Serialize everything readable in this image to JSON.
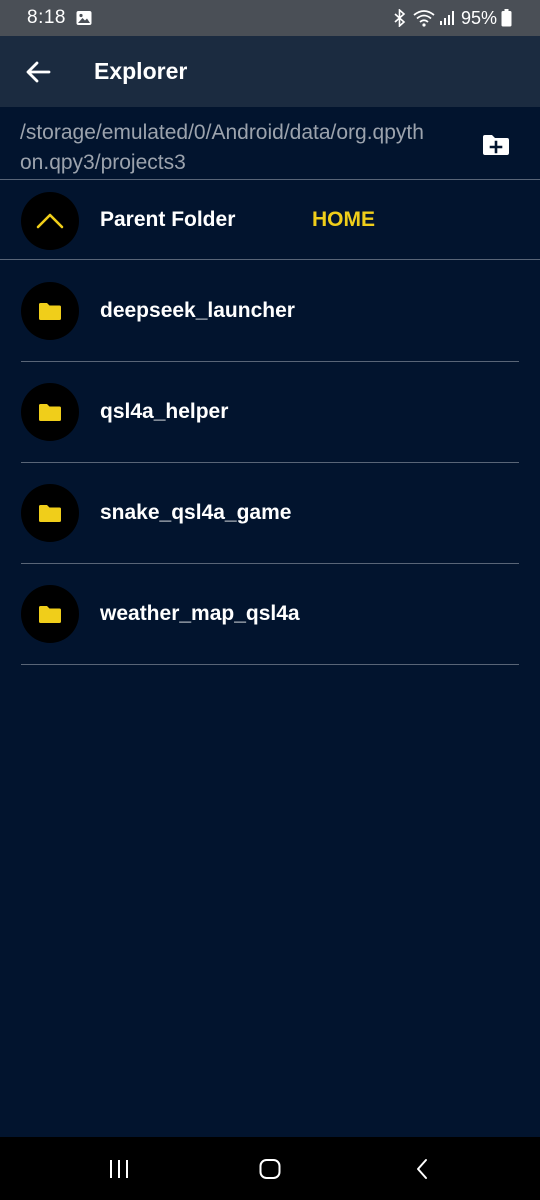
{
  "status_bar": {
    "time": "8:18",
    "battery": "95%",
    "icons": [
      "image-icon",
      "bluetooth-icon",
      "wifi-icon",
      "signal-icon",
      "battery-icon"
    ]
  },
  "app_bar": {
    "title": "Explorer",
    "back_icon": "arrow-left-icon"
  },
  "path": {
    "text": "/storage/emulated/0/Android/data/org.qpython.qpy3/projects3",
    "action_icon": "new-folder-icon"
  },
  "parent": {
    "label": "Parent Folder",
    "home_label": "HOME",
    "icon": "chevron-up-icon"
  },
  "folders": [
    {
      "name": "deepseek_launcher",
      "icon": "folder-icon"
    },
    {
      "name": "qsl4a_helper",
      "icon": "folder-icon"
    },
    {
      "name": "snake_qsl4a_game",
      "icon": "folder-icon"
    },
    {
      "name": "weather_map_qsl4a",
      "icon": "folder-icon"
    }
  ],
  "nav_bar": {
    "icons": [
      "recent-apps-icon",
      "home-icon",
      "nav-back-icon"
    ]
  },
  "colors": {
    "background": "#02142E",
    "app_bar": "#1B2B40",
    "status_bar": "#4A4F56",
    "accent": "#F0CE1A",
    "path_text": "#9CA3AD",
    "divider": "#596577"
  }
}
